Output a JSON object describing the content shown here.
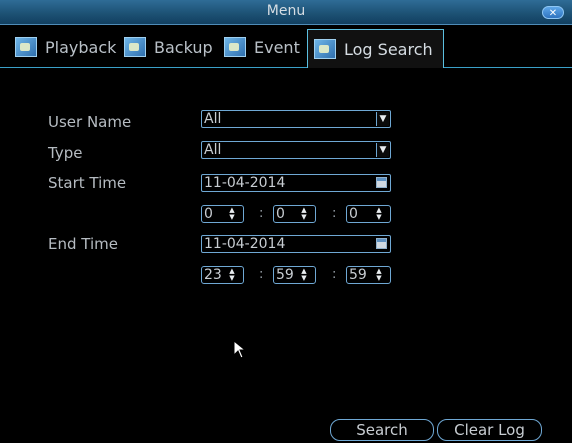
{
  "window": {
    "title": "Menu"
  },
  "tabs": [
    {
      "label": "Playback"
    },
    {
      "label": "Backup"
    },
    {
      "label": "Event"
    },
    {
      "label": "Log Search",
      "active": true
    }
  ],
  "form": {
    "user_name": {
      "label": "User Name",
      "value": "All"
    },
    "type": {
      "label": "Type",
      "value": "All"
    },
    "start_time": {
      "label": "Start Time",
      "date": "11-04-2014",
      "hour": "0",
      "minute": "0",
      "second": "0"
    },
    "end_time": {
      "label": "End Time",
      "date": "11-04-2014",
      "hour": "23",
      "minute": "59",
      "second": "59"
    },
    "time_separator": ":"
  },
  "buttons": {
    "search": "Search",
    "clear_log": "Clear Log"
  },
  "colors": {
    "accent": "#6fa8d4",
    "titlebar": "#1d5275",
    "background": "#000000"
  },
  "icons": {
    "tab_icon": "photo-icon",
    "close": "close-icon",
    "calendar": "calendar-icon",
    "dropdown": "chevron-down-icon"
  }
}
